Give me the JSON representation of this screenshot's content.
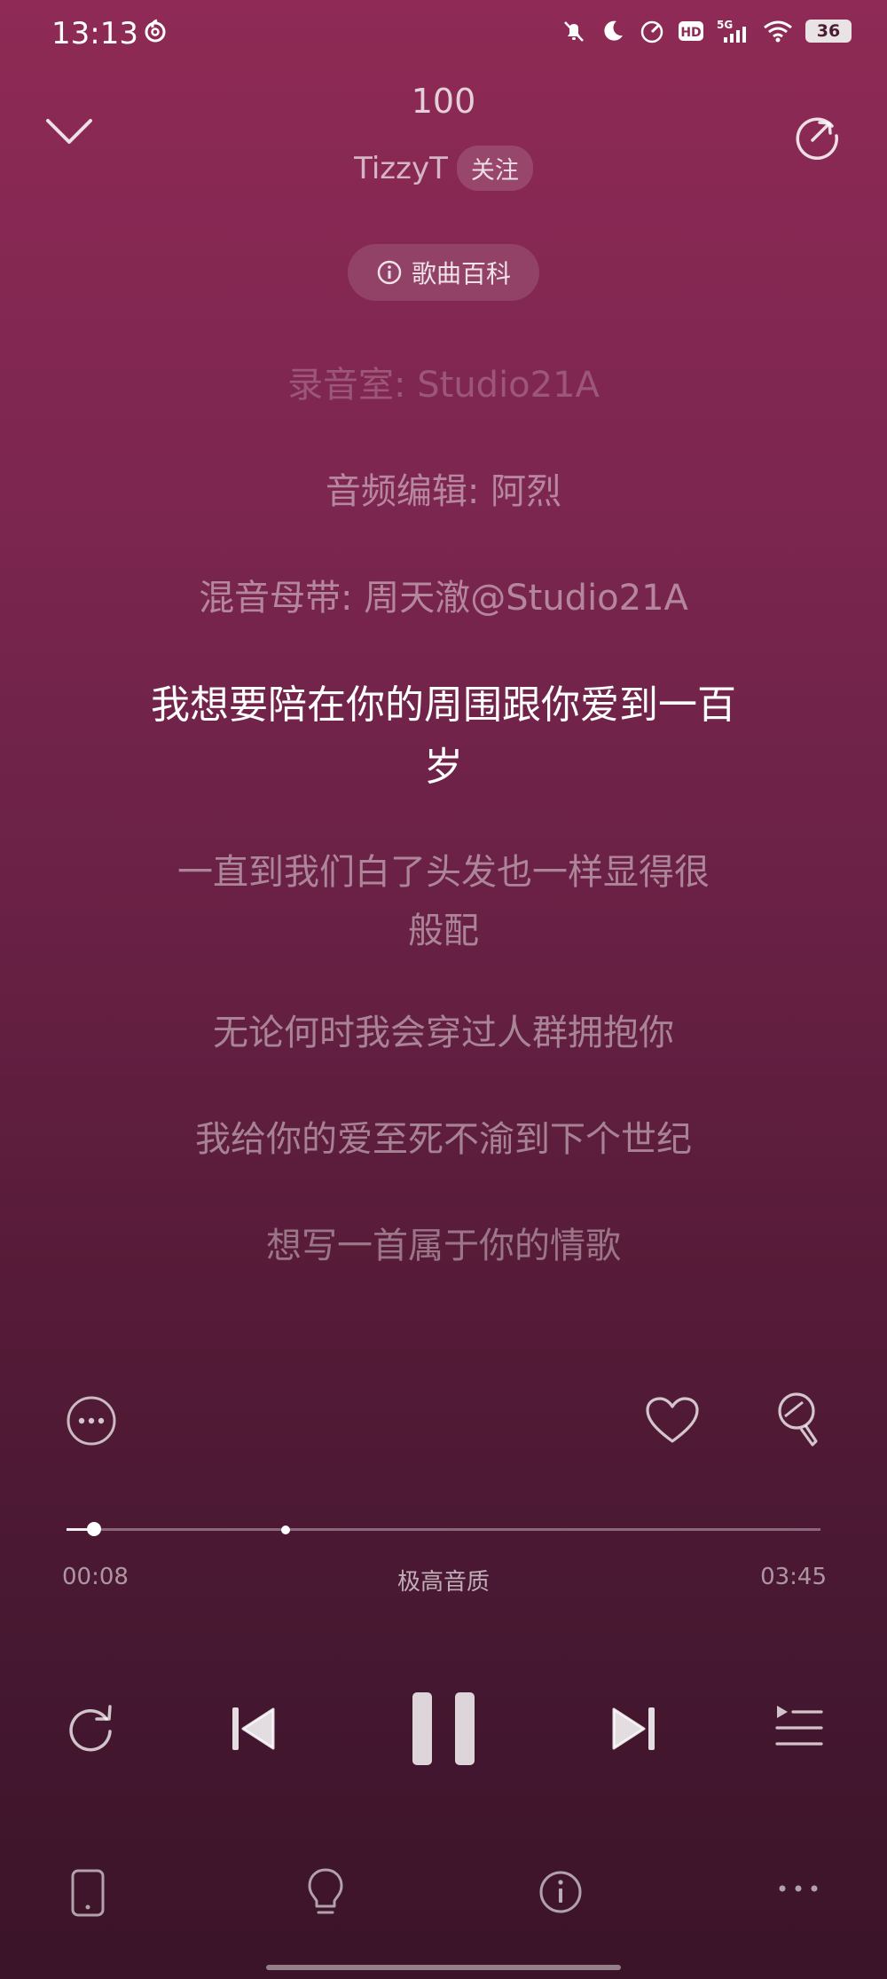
{
  "status_bar": {
    "time": "13:13",
    "network": "5G",
    "battery": "36"
  },
  "header": {
    "song_title": "100",
    "artist": "TizzyT",
    "follow_label": "关注",
    "wiki_label": "歌曲百科"
  },
  "lyrics": [
    {
      "text": "录音室: Studio21A",
      "state": "faded"
    },
    {
      "text": "音频编辑: 阿烈",
      "state": "dim"
    },
    {
      "text": "混音母带: 周天澈@Studio21A",
      "state": "dim"
    },
    {
      "text": "我想要陪在你的周围跟你爱到一百\n岁",
      "state": "current"
    },
    {
      "text": "一直到我们白了头发也一样显得很\n般配",
      "state": "dim"
    },
    {
      "text": "无论何时我会穿过人群拥抱你",
      "state": "dim"
    },
    {
      "text": "我给你的爱至死不渝到下个世纪",
      "state": "dim"
    },
    {
      "text": "想写一首属于你的情歌",
      "state": "dim"
    }
  ],
  "player": {
    "elapsed": "00:08",
    "duration": "03:45",
    "quality": "极高音质",
    "progress_fraction": 0.036,
    "marker_fraction": 0.29
  },
  "colors": {
    "bg_top": "#8e2a55",
    "bg_bottom": "#3b1429",
    "accent": "#ffffff"
  }
}
